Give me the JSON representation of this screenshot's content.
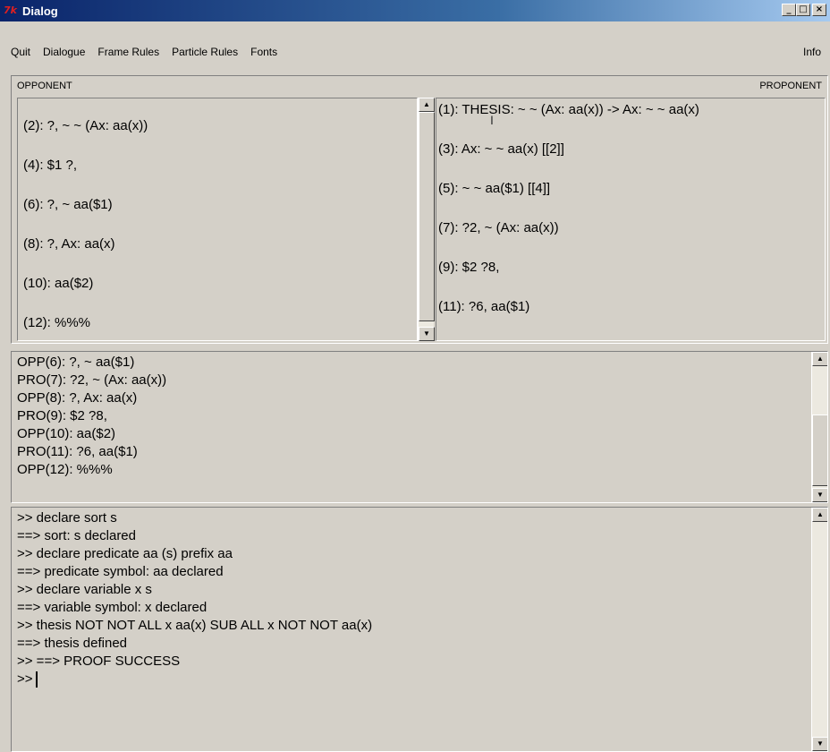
{
  "window": {
    "title": "Dialog",
    "icon": "tk-icon",
    "app_icon_text": "7k",
    "controls": [
      "_",
      "□",
      "×"
    ]
  },
  "menubar": {
    "items": [
      "Quit",
      "Dialogue",
      "Frame Rules",
      "Particle Rules",
      "Fonts"
    ],
    "info": "Info"
  },
  "panels": {
    "opponent_label": "OPPONENT",
    "proponent_label": "PROPONENT",
    "opponent": [
      "(2):  ?, ~ ~ (Ax: aa(x))",
      "(4): $1 ?,",
      "(6):  ?, ~ aa($1)",
      "(8):  ?,  Ax: aa(x)",
      "(10): aa($2)",
      "(12): %%%"
    ],
    "proponent": [
      "(1): THESIS: ~ ~ (Ax: aa(x)) -> Ax: ~ ~ aa(x)",
      "(3): Ax: ~ ~ aa(x) [[2]]",
      "(5): ~ ~ aa($1) [[4]]",
      "(7):  ?2, ~ (Ax: aa(x))",
      "(9): $2 ?8,",
      "(11):  ?6,  aa($1)"
    ]
  },
  "moves": [
    "OPP(6):  ?, ~ aa($1)",
    "PRO(7):  ?2, ~ (Ax: aa(x))",
    "OPP(8):  ?,  Ax: aa(x)",
    "PRO(9): $2 ?8,",
    "OPP(10): aa($2)",
    "PRO(11):  ?6,  aa($1)",
    "OPP(12): %%%"
  ],
  "console": {
    "lines": [
      ">> declare sort s",
      "==> sort: s declared",
      ">> declare predicate aa (s) prefix aa",
      "==> predicate symbol: aa declared",
      ">> declare variable x s",
      "==> variable symbol: x declared",
      ">> thesis NOT NOT ALL x aa(x) SUB ALL x NOT NOT aa(x)",
      "==> thesis defined",
      ">> ==> PROOF SUCCESS"
    ],
    "prompt": ">>"
  }
}
